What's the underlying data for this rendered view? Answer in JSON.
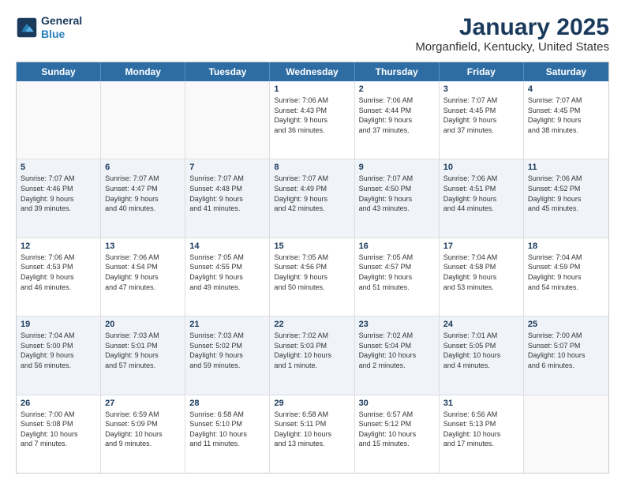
{
  "header": {
    "logo_line1": "General",
    "logo_line2": "Blue",
    "title": "January 2025",
    "subtitle": "Morganfield, Kentucky, United States"
  },
  "days_of_week": [
    "Sunday",
    "Monday",
    "Tuesday",
    "Wednesday",
    "Thursday",
    "Friday",
    "Saturday"
  ],
  "weeks": [
    [
      {
        "day": "",
        "info": ""
      },
      {
        "day": "",
        "info": ""
      },
      {
        "day": "",
        "info": ""
      },
      {
        "day": "1",
        "info": "Sunrise: 7:06 AM\nSunset: 4:43 PM\nDaylight: 9 hours\nand 36 minutes."
      },
      {
        "day": "2",
        "info": "Sunrise: 7:06 AM\nSunset: 4:44 PM\nDaylight: 9 hours\nand 37 minutes."
      },
      {
        "day": "3",
        "info": "Sunrise: 7:07 AM\nSunset: 4:45 PM\nDaylight: 9 hours\nand 37 minutes."
      },
      {
        "day": "4",
        "info": "Sunrise: 7:07 AM\nSunset: 4:45 PM\nDaylight: 9 hours\nand 38 minutes."
      }
    ],
    [
      {
        "day": "5",
        "info": "Sunrise: 7:07 AM\nSunset: 4:46 PM\nDaylight: 9 hours\nand 39 minutes."
      },
      {
        "day": "6",
        "info": "Sunrise: 7:07 AM\nSunset: 4:47 PM\nDaylight: 9 hours\nand 40 minutes."
      },
      {
        "day": "7",
        "info": "Sunrise: 7:07 AM\nSunset: 4:48 PM\nDaylight: 9 hours\nand 41 minutes."
      },
      {
        "day": "8",
        "info": "Sunrise: 7:07 AM\nSunset: 4:49 PM\nDaylight: 9 hours\nand 42 minutes."
      },
      {
        "day": "9",
        "info": "Sunrise: 7:07 AM\nSunset: 4:50 PM\nDaylight: 9 hours\nand 43 minutes."
      },
      {
        "day": "10",
        "info": "Sunrise: 7:06 AM\nSunset: 4:51 PM\nDaylight: 9 hours\nand 44 minutes."
      },
      {
        "day": "11",
        "info": "Sunrise: 7:06 AM\nSunset: 4:52 PM\nDaylight: 9 hours\nand 45 minutes."
      }
    ],
    [
      {
        "day": "12",
        "info": "Sunrise: 7:06 AM\nSunset: 4:53 PM\nDaylight: 9 hours\nand 46 minutes."
      },
      {
        "day": "13",
        "info": "Sunrise: 7:06 AM\nSunset: 4:54 PM\nDaylight: 9 hours\nand 47 minutes."
      },
      {
        "day": "14",
        "info": "Sunrise: 7:05 AM\nSunset: 4:55 PM\nDaylight: 9 hours\nand 49 minutes."
      },
      {
        "day": "15",
        "info": "Sunrise: 7:05 AM\nSunset: 4:56 PM\nDaylight: 9 hours\nand 50 minutes."
      },
      {
        "day": "16",
        "info": "Sunrise: 7:05 AM\nSunset: 4:57 PM\nDaylight: 9 hours\nand 51 minutes."
      },
      {
        "day": "17",
        "info": "Sunrise: 7:04 AM\nSunset: 4:58 PM\nDaylight: 9 hours\nand 53 minutes."
      },
      {
        "day": "18",
        "info": "Sunrise: 7:04 AM\nSunset: 4:59 PM\nDaylight: 9 hours\nand 54 minutes."
      }
    ],
    [
      {
        "day": "19",
        "info": "Sunrise: 7:04 AM\nSunset: 5:00 PM\nDaylight: 9 hours\nand 56 minutes."
      },
      {
        "day": "20",
        "info": "Sunrise: 7:03 AM\nSunset: 5:01 PM\nDaylight: 9 hours\nand 57 minutes."
      },
      {
        "day": "21",
        "info": "Sunrise: 7:03 AM\nSunset: 5:02 PM\nDaylight: 9 hours\nand 59 minutes."
      },
      {
        "day": "22",
        "info": "Sunrise: 7:02 AM\nSunset: 5:03 PM\nDaylight: 10 hours\nand 1 minute."
      },
      {
        "day": "23",
        "info": "Sunrise: 7:02 AM\nSunset: 5:04 PM\nDaylight: 10 hours\nand 2 minutes."
      },
      {
        "day": "24",
        "info": "Sunrise: 7:01 AM\nSunset: 5:05 PM\nDaylight: 10 hours\nand 4 minutes."
      },
      {
        "day": "25",
        "info": "Sunrise: 7:00 AM\nSunset: 5:07 PM\nDaylight: 10 hours\nand 6 minutes."
      }
    ],
    [
      {
        "day": "26",
        "info": "Sunrise: 7:00 AM\nSunset: 5:08 PM\nDaylight: 10 hours\nand 7 minutes."
      },
      {
        "day": "27",
        "info": "Sunrise: 6:59 AM\nSunset: 5:09 PM\nDaylight: 10 hours\nand 9 minutes."
      },
      {
        "day": "28",
        "info": "Sunrise: 6:58 AM\nSunset: 5:10 PM\nDaylight: 10 hours\nand 11 minutes."
      },
      {
        "day": "29",
        "info": "Sunrise: 6:58 AM\nSunset: 5:11 PM\nDaylight: 10 hours\nand 13 minutes."
      },
      {
        "day": "30",
        "info": "Sunrise: 6:57 AM\nSunset: 5:12 PM\nDaylight: 10 hours\nand 15 minutes."
      },
      {
        "day": "31",
        "info": "Sunrise: 6:56 AM\nSunset: 5:13 PM\nDaylight: 10 hours\nand 17 minutes."
      },
      {
        "day": "",
        "info": ""
      }
    ]
  ]
}
